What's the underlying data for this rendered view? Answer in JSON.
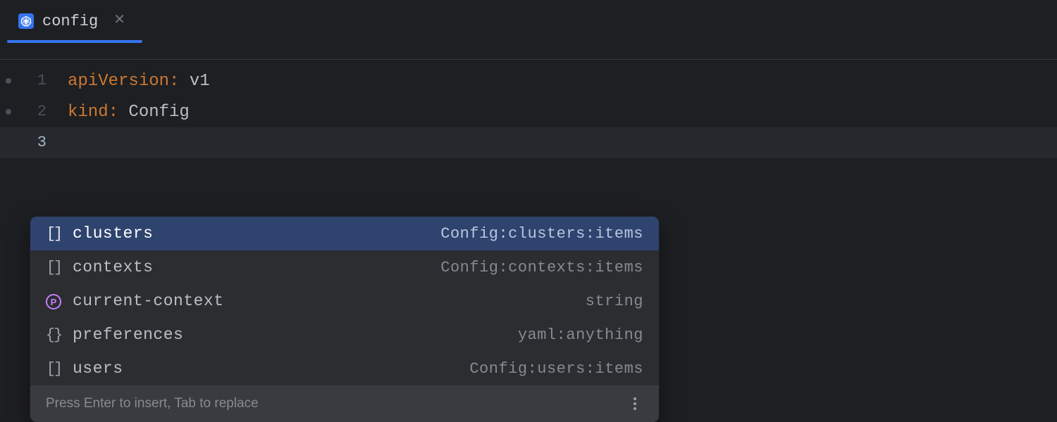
{
  "tab": {
    "title": "config",
    "icon": "kubernetes-icon"
  },
  "code": {
    "lines": [
      {
        "num": "1",
        "key": "apiVersion",
        "value": "v1"
      },
      {
        "num": "2",
        "key": "kind",
        "value": "Config"
      },
      {
        "num": "3",
        "key": "",
        "value": ""
      }
    ],
    "current_line_index": 2
  },
  "completion": {
    "items": [
      {
        "icon": "array",
        "label": "clusters",
        "type": "Config:clusters:items",
        "selected": true
      },
      {
        "icon": "array",
        "label": "contexts",
        "type": "Config:contexts:items",
        "selected": false
      },
      {
        "icon": "prop",
        "label": "current-context",
        "type": "string",
        "selected": false
      },
      {
        "icon": "object",
        "label": "preferences",
        "type": "yaml:anything",
        "selected": false
      },
      {
        "icon": "array",
        "label": "users",
        "type": "Config:users:items",
        "selected": false
      }
    ],
    "hint": "Press Enter to insert, Tab to replace"
  }
}
